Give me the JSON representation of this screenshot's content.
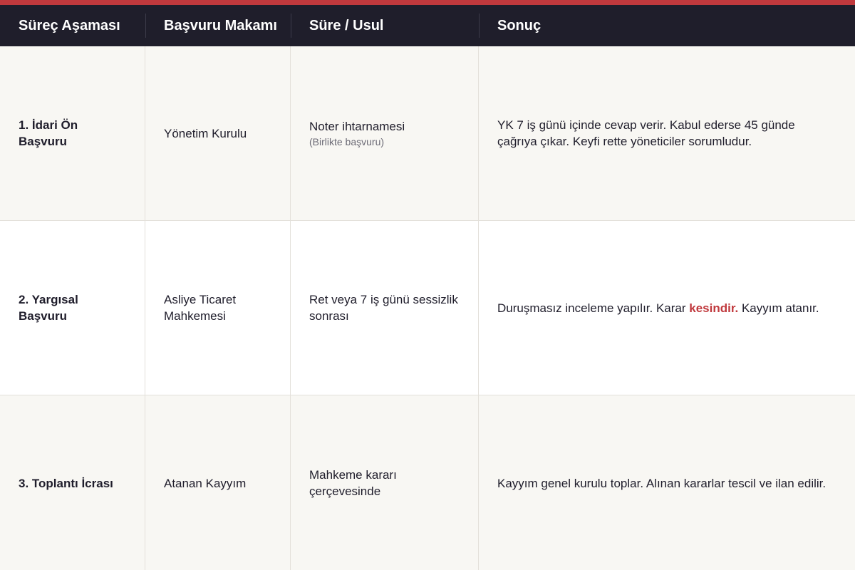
{
  "header": {
    "col1": "Süreç Aşaması",
    "col2": "Başvuru Makamı",
    "col3": "Süre / Usul",
    "col4": "Sonuç"
  },
  "rows": [
    {
      "stage_line1": "1. İdari Ön",
      "stage_line2": "Başvuru",
      "authority": "Yönetim Kurulu",
      "method": "Noter ihtarnamesi",
      "method_note": "(Birlikte başvuru)",
      "result": "YK 7 iş günü içinde cevap verir. Kabul ederse 45 günde çağrıya çıkar. Keyfi rette yöneticiler sorumludur."
    },
    {
      "stage_line1": "2. Yargısal",
      "stage_line2": "Başvuru",
      "authority": "Asliye Ticaret Mahkemesi",
      "method": "Ret veya 7 iş günü sessizlik sonrası",
      "result_before": "Duruşmasız inceleme yapılır. Karar ",
      "result_highlight": "kesindir.",
      "result_after": " Kayyım atanır."
    },
    {
      "stage": "3. Toplantı İcrası",
      "authority": "Atanan Kayyım",
      "method": "Mahkeme kararı çerçevesinde",
      "result": "Kayyım genel kurulu toplar. Alınan kararlar tescil ve ilan edilir."
    }
  ],
  "colors": {
    "accent": "#c0393d",
    "header_bg": "#1f1e2b",
    "row_alt_bg": "#f8f7f3"
  }
}
